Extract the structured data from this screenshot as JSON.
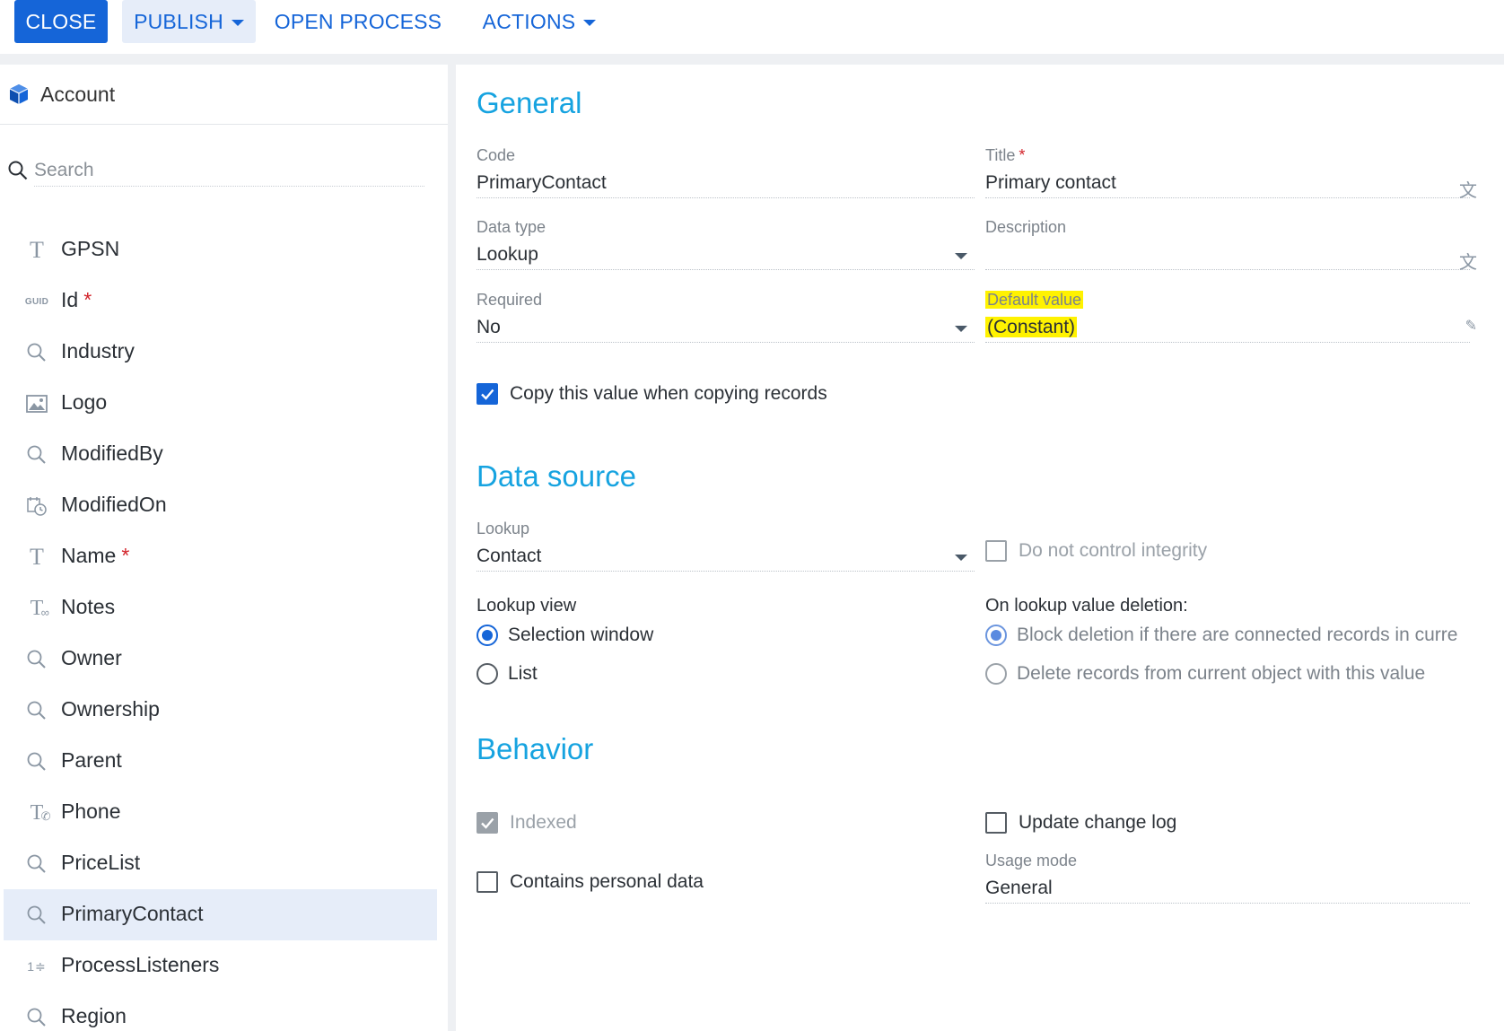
{
  "toolbar": {
    "close_label": "CLOSE",
    "publish_label": "PUBLISH",
    "open_process_label": "OPEN PROCESS",
    "actions_label": "ACTIONS"
  },
  "object": {
    "title": "Account"
  },
  "search": {
    "placeholder": "Search"
  },
  "columns": [
    {
      "label": "GPSN",
      "icon": "text-icon",
      "required": false
    },
    {
      "label": "Id",
      "icon": "guid-icon",
      "required": true
    },
    {
      "label": "Industry",
      "icon": "lookup-icon",
      "required": false
    },
    {
      "label": "Logo",
      "icon": "image-icon",
      "required": false
    },
    {
      "label": "ModifiedBy",
      "icon": "lookup-icon",
      "required": false
    },
    {
      "label": "ModifiedOn",
      "icon": "datetime-icon",
      "required": false
    },
    {
      "label": "Name",
      "icon": "text-icon",
      "required": true
    },
    {
      "label": "Notes",
      "icon": "unlimited-text-icon",
      "required": false
    },
    {
      "label": "Owner",
      "icon": "lookup-icon",
      "required": false
    },
    {
      "label": "Ownership",
      "icon": "lookup-icon",
      "required": false
    },
    {
      "label": "Parent",
      "icon": "lookup-icon",
      "required": false
    },
    {
      "label": "Phone",
      "icon": "phone-text-icon",
      "required": false
    },
    {
      "label": "PriceList",
      "icon": "lookup-icon",
      "required": false
    },
    {
      "label": "PrimaryContact",
      "icon": "lookup-icon",
      "required": false,
      "selected": true
    },
    {
      "label": "ProcessListeners",
      "icon": "integer-icon",
      "required": false
    },
    {
      "label": "Region",
      "icon": "lookup-icon",
      "required": false
    }
  ],
  "general": {
    "title": "General",
    "code": {
      "label": "Code",
      "value": "PrimaryContact"
    },
    "title_field": {
      "label": "Title",
      "value": "Primary contact"
    },
    "data_type": {
      "label": "Data type",
      "value": "Lookup"
    },
    "description": {
      "label": "Description",
      "value": ""
    },
    "required": {
      "label": "Required",
      "value": "No"
    },
    "default_value": {
      "label": "Default value",
      "value": "(Constant)"
    },
    "copy_value": {
      "label": "Copy this value when copying records",
      "checked": true
    }
  },
  "data_source": {
    "title": "Data source",
    "lookup": {
      "label": "Lookup",
      "value": "Contact"
    },
    "do_not_control_integrity": {
      "label": "Do not control integrity",
      "checked": false
    },
    "lookup_view": {
      "label": "Lookup view",
      "options": [
        "Selection window",
        "List"
      ],
      "selected": "Selection window"
    },
    "on_deletion": {
      "label": "On lookup value deletion:",
      "options": [
        "Block deletion if there are connected records in curre",
        "Delete records from current object with this value"
      ],
      "selected": "Block deletion if there are connected records in curre"
    }
  },
  "behavior": {
    "title": "Behavior",
    "indexed": {
      "label": "Indexed",
      "checked": true
    },
    "update_change_log": {
      "label": "Update change log",
      "checked": false
    },
    "contains_personal_data": {
      "label": "Contains personal data",
      "checked": false
    },
    "usage_mode": {
      "label": "Usage mode",
      "value": "General"
    }
  },
  "colors": {
    "primary": "#1565d8",
    "section_title": "#16a3e0",
    "selected_row": "#e6edf9",
    "highlight": "#fff200",
    "required": "#d2232a"
  }
}
